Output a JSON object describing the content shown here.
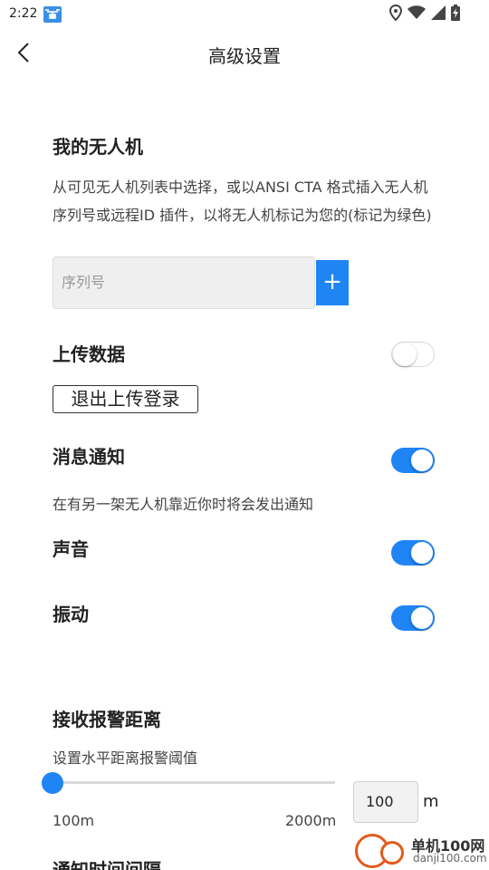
{
  "status_bar": {
    "time": "2:22",
    "app_icon": "drone-notification-icon",
    "icons": [
      "location-icon",
      "wifi-icon",
      "signal-icon",
      "battery-charging-icon"
    ]
  },
  "app_bar": {
    "back_icon": "back-arrow-icon",
    "title": "高级设置"
  },
  "my_drones": {
    "title": "我的无人机",
    "description": "从可见无人机列表中选择，或以ANSI CTA 格式插入无人机序列号或远程ID 插件，以将无人机标记为您的(标记为绿色)",
    "serial_placeholder": "序列号",
    "add_label": "+"
  },
  "upload_data": {
    "title": "上传数据",
    "enabled": false,
    "logout_label": "退出上传登录"
  },
  "notifications": {
    "title": "消息通知",
    "enabled": true,
    "description": "在有另一架无人机靠近你时将会发出通知"
  },
  "sound": {
    "title": "声音",
    "enabled": true
  },
  "vibration": {
    "title": "振动",
    "enabled": true
  },
  "alert_distance": {
    "title": "接收报警距离",
    "description": "设置水平距离报警阈值",
    "min_label": "100m",
    "max_label": "2000m",
    "value": "100",
    "unit": "m"
  },
  "notify_interval": {
    "title": "通知时间间隔"
  },
  "watermark": {
    "name": "单机100网",
    "url": "danji100.com"
  },
  "colors": {
    "accent": "#1f85f5",
    "watermark": "#e25a1c"
  }
}
